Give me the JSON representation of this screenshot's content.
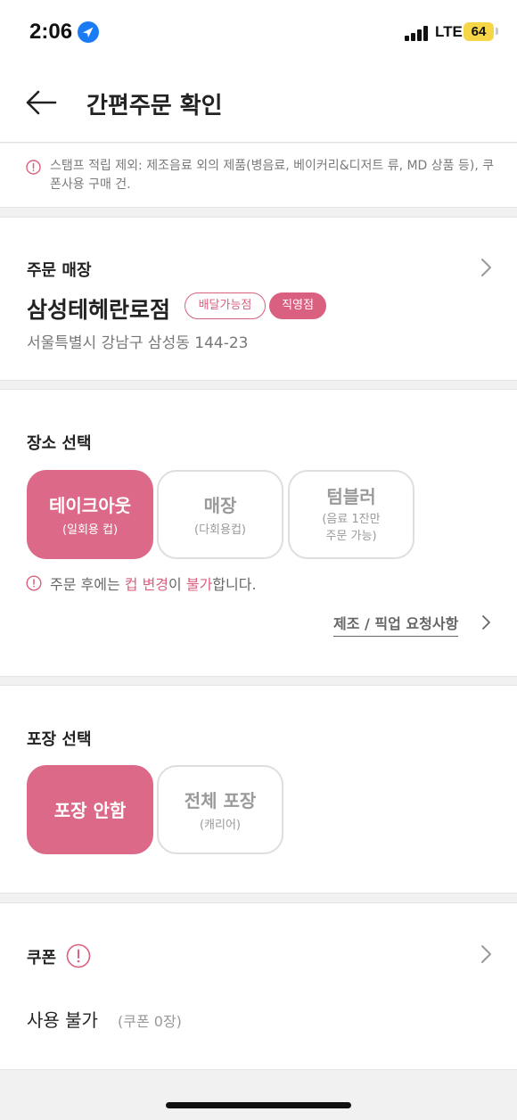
{
  "status_bar": {
    "time": "2:06",
    "network": "LTE",
    "battery": "64",
    "icons": [
      "location-arrow-icon",
      "signal-bars-icon",
      "battery-icon"
    ]
  },
  "nav": {
    "title": "간편주문 확인",
    "back_icon": "arrow-left-icon"
  },
  "notice": {
    "icon": "info-circle-icon",
    "text": "스탬프 적립 제외: 제조음료 외의 제품(병음료, 베이커리&디저트 류, MD 상품 등), 쿠폰사용 구매 건."
  },
  "store": {
    "label": "주문 매장",
    "name": "삼성테헤란로점",
    "badges": [
      "배달가능점",
      "직영점"
    ],
    "address": "서울특별시 강남구 삼성동 144-23"
  },
  "place": {
    "label": "장소 선택",
    "options": [
      {
        "main": "테이크아웃",
        "sub": "(일회용 컵)",
        "selected": true
      },
      {
        "main": "매장",
        "sub": "(다회용컵)",
        "selected": false
      },
      {
        "main": "텀블러",
        "sub_line1": "(음료 1잔만",
        "sub_line2": "주문 가능)",
        "selected": false
      }
    ],
    "note": {
      "part1": "주문 후에는 ",
      "hl1": "컵 변경",
      "part2": "이 ",
      "hl2": "불가",
      "part3": "합니다."
    },
    "request_link": "제조 / 픽업 요청사항"
  },
  "packaging": {
    "label": "포장 선택",
    "options": [
      {
        "main": "포장 안함",
        "selected": true
      },
      {
        "main": "전체 포장",
        "sub": "(캐리어)",
        "selected": false
      }
    ]
  },
  "coupon": {
    "label": "쿠폰",
    "status": "사용 불가",
    "count": "(쿠폰 0장)"
  },
  "colors": {
    "accent": "#db6987",
    "badge_pink": "#d9607e",
    "background": "#f1f1f1",
    "location_blue": "#1a7cf5",
    "battery_yellow": "#f6d646"
  }
}
